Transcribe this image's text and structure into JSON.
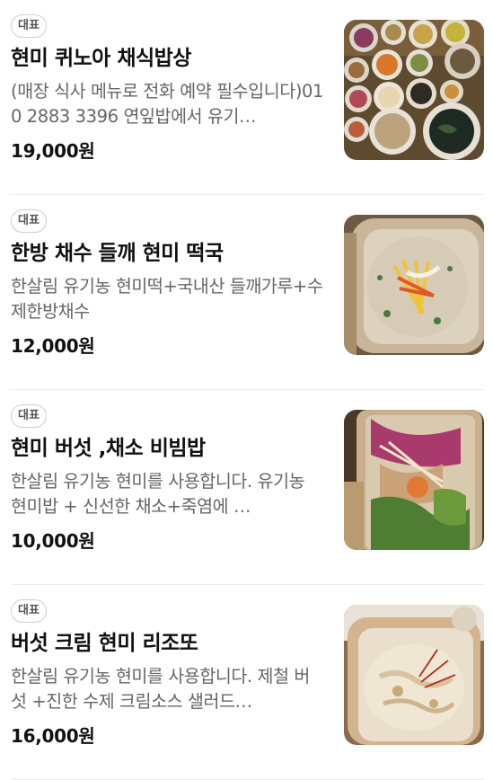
{
  "menu": {
    "items": [
      {
        "badge": "대표",
        "name": "현미 퀴노아 채식밥상",
        "description": "(매장 식사 메뉴로 전화 예약 필수입니다)010 2883 3396 연잎밥에서 유기…",
        "price": "19,000원",
        "image_icon": "food-photo-icon"
      },
      {
        "badge": "대표",
        "name": "한방 채수 들깨 현미 떡국",
        "description": "한살림 유기농 현미떡+국내산 들깨가루+수제한방채수",
        "price": "12,000원",
        "image_icon": "food-photo-icon"
      },
      {
        "badge": "대표",
        "name": "현미 버섯 ,채소 비빔밥",
        "description": "한살림 유기농 현미를 사용합니다. 유기농 현미밥 + 신선한 채소+죽염에 …",
        "price": "10,000원",
        "image_icon": "food-photo-icon"
      },
      {
        "badge": "대표",
        "name": "버섯 크림 현미 리조또",
        "description": "한살림 유기농 현미를 사용합니다. 제철 버섯 +진한 수제 크림소스 샐러드…",
        "price": "16,000원",
        "image_icon": "food-photo-icon"
      }
    ]
  }
}
